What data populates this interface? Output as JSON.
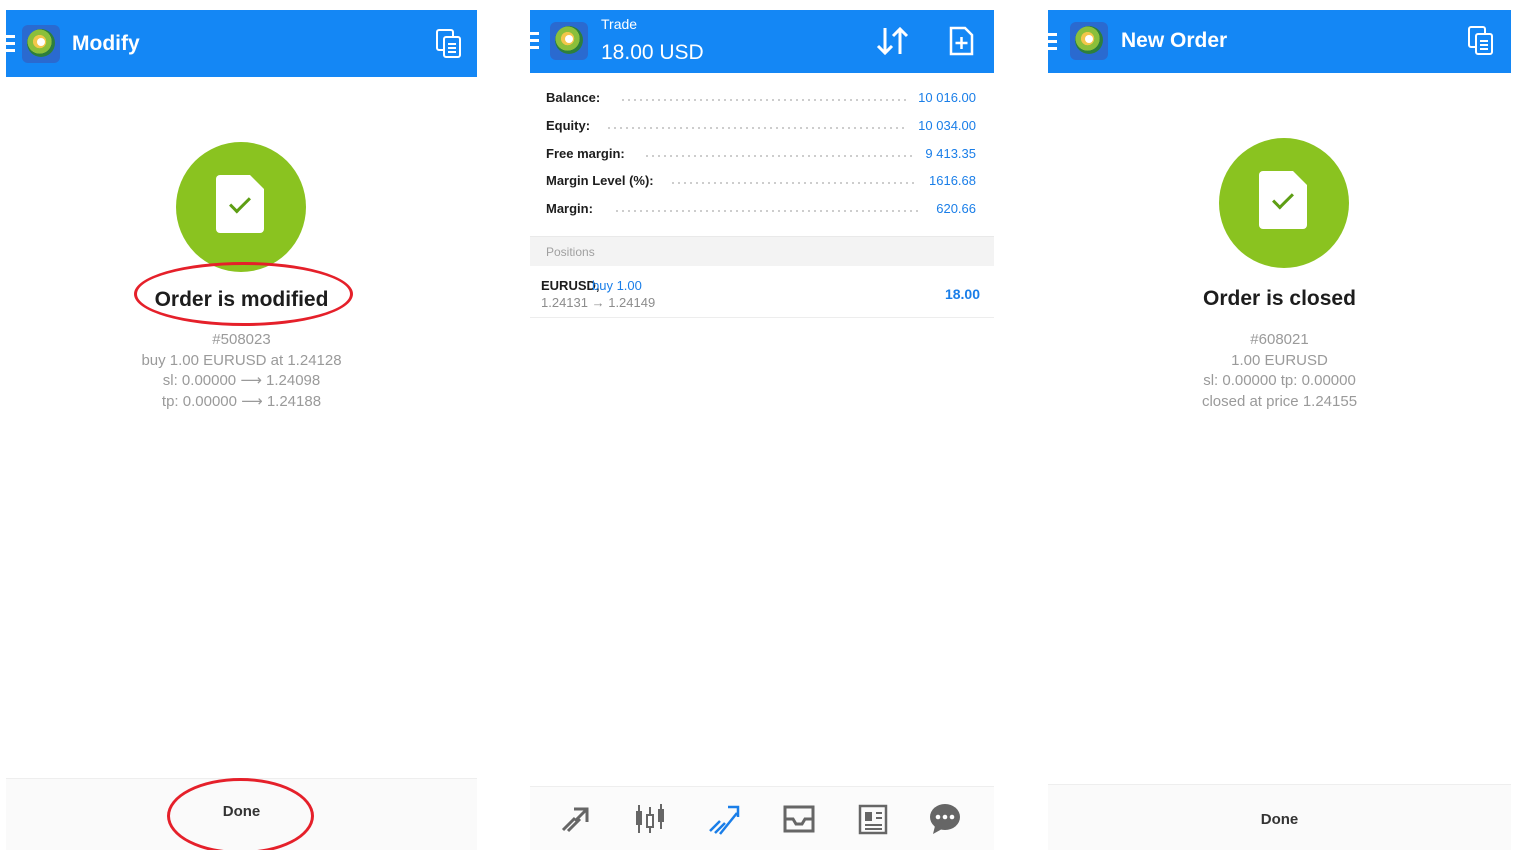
{
  "colors": {
    "accent": "#1487f5",
    "success": "#8ac320",
    "highlight_ring": "#e5202a",
    "value_blue": "#1a7ee8"
  },
  "screen_modify": {
    "header": {
      "title": "Modify",
      "menu_icon": "menu-icon",
      "logo_icon": "metatrader-logo-icon",
      "action_icon": "copy-icon"
    },
    "status_icon": "order-success-icon",
    "title": "Order is modified",
    "details": [
      "#508023",
      "buy 1.00 EURUSD at 1.24128",
      "sl: 0.00000 ⟶ 1.24098",
      "tp: 0.00000 ⟶ 1.24188"
    ],
    "done_label": "Done"
  },
  "screen_trade": {
    "header": {
      "subtitle": "Trade",
      "balance": "18.00 USD",
      "menu_icon": "menu-icon",
      "logo_icon": "metatrader-logo-icon",
      "sort_icon": "sort-icon",
      "new_order_icon": "new-order-icon"
    },
    "summary": [
      {
        "label": "Balance:",
        "value": "10 016.00"
      },
      {
        "label": "Equity:",
        "value": "10 034.00"
      },
      {
        "label": "Free margin:",
        "value": "9 413.35"
      },
      {
        "label": "Margin Level (%):",
        "value": "1616.68"
      },
      {
        "label": "Margin:",
        "value": "620.66"
      }
    ],
    "positions_header": "Positions",
    "position": {
      "symbol": "EURUSD,",
      "type": "buy 1.00",
      "prices": "1.24131 → 1.24149",
      "profit": "18.00"
    },
    "nav": [
      "quotes-icon",
      "chart-icon",
      "trade-icon",
      "mailbox-icon",
      "news-icon",
      "chat-icon"
    ]
  },
  "screen_closed": {
    "header": {
      "title": "New Order",
      "menu_icon": "menu-icon",
      "logo_icon": "metatrader-logo-icon",
      "action_icon": "copy-icon"
    },
    "status_icon": "order-success-icon",
    "title": "Order is closed",
    "details": [
      "#608021",
      "1.00 EURUSD",
      "sl: 0.00000 tp: 0.00000",
      "closed at price 1.24155"
    ],
    "done_label": "Done"
  }
}
